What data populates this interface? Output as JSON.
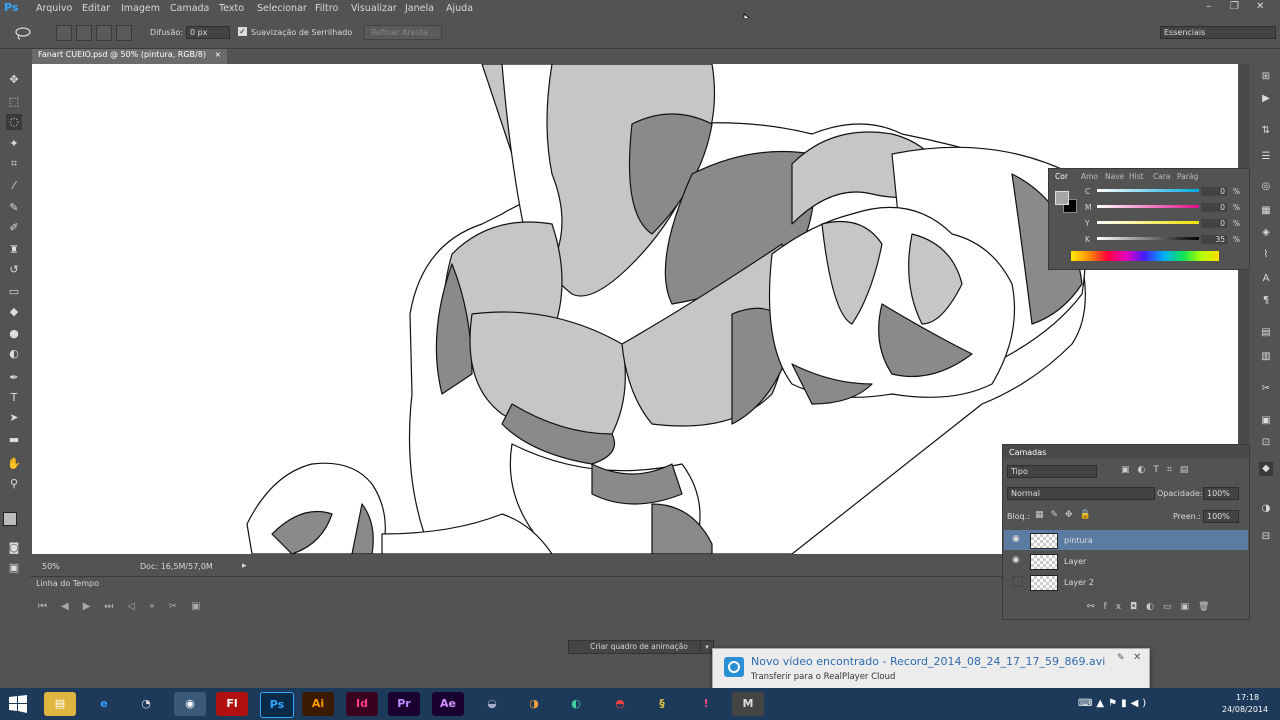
{
  "app": {
    "logo": "Ps"
  },
  "menu": [
    "Arquivo",
    "Editar",
    "Imagem",
    "Camada",
    "Texto",
    "Selecionar",
    "Filtro",
    "Visualizar",
    "Janela",
    "Ajuda"
  ],
  "window_controls": {
    "minimize": "–",
    "restore": "❐",
    "close": "✕"
  },
  "options": {
    "feather_label": "Difusão:",
    "feather_value": "0 px",
    "antialias_label": "Suavização de Serrilhado",
    "antialias_checked": true,
    "refine_edge": "Refinar Aresta...",
    "workspace": "Essenciais"
  },
  "document": {
    "tab_title": "Fanart CUEIO.psd @ 50% (pintura, RGB/8)",
    "close": "×"
  },
  "status": {
    "zoom": "50%",
    "doc_size": "Doc: 16,5M/57,0M"
  },
  "timeline": {
    "title": "Linha do Tempo",
    "create_frame": "Criar quadro de animação"
  },
  "color_panel": {
    "tabs": [
      "Cor",
      "Amo",
      "Nave",
      "Hist",
      "Cara",
      "Parág"
    ],
    "channels": [
      {
        "label": "C",
        "value": "0",
        "unit": "%"
      },
      {
        "label": "M",
        "value": "0",
        "unit": "%"
      },
      {
        "label": "Y",
        "value": "0",
        "unit": "%"
      },
      {
        "label": "K",
        "value": "35",
        "unit": "%"
      }
    ]
  },
  "layers_panel": {
    "title": "Camadas",
    "filter": "Tipo",
    "blend_mode": "Normal",
    "opacity_label": "Opacidade:",
    "opacity_value": "100%",
    "lock_label": "Bloq.:",
    "fill_label": "Preen.:",
    "fill_value": "100%",
    "layers": [
      {
        "name": "pintura",
        "visible": true,
        "selected": true
      },
      {
        "name": "Layer",
        "visible": true,
        "selected": false
      },
      {
        "name": "Layer 2",
        "visible": false,
        "selected": false
      }
    ]
  },
  "notification": {
    "title": "Novo vídeo encontrado - Record_2014_08_24_17_17_59_869.avi",
    "subtitle": "Transferir para o RealPlayer Cloud"
  },
  "taskbar": {
    "apps": [
      "Fl",
      "Ps",
      "Ai",
      "Id",
      "Pr",
      "Ae",
      "M"
    ],
    "clock_time": "17:18",
    "clock_date": "24/08/2014"
  },
  "colors": {
    "accent": "#31a8ff",
    "taskbar": "#1d3a5a",
    "panel": "#535353",
    "selected_layer": "#5b7ba2"
  }
}
